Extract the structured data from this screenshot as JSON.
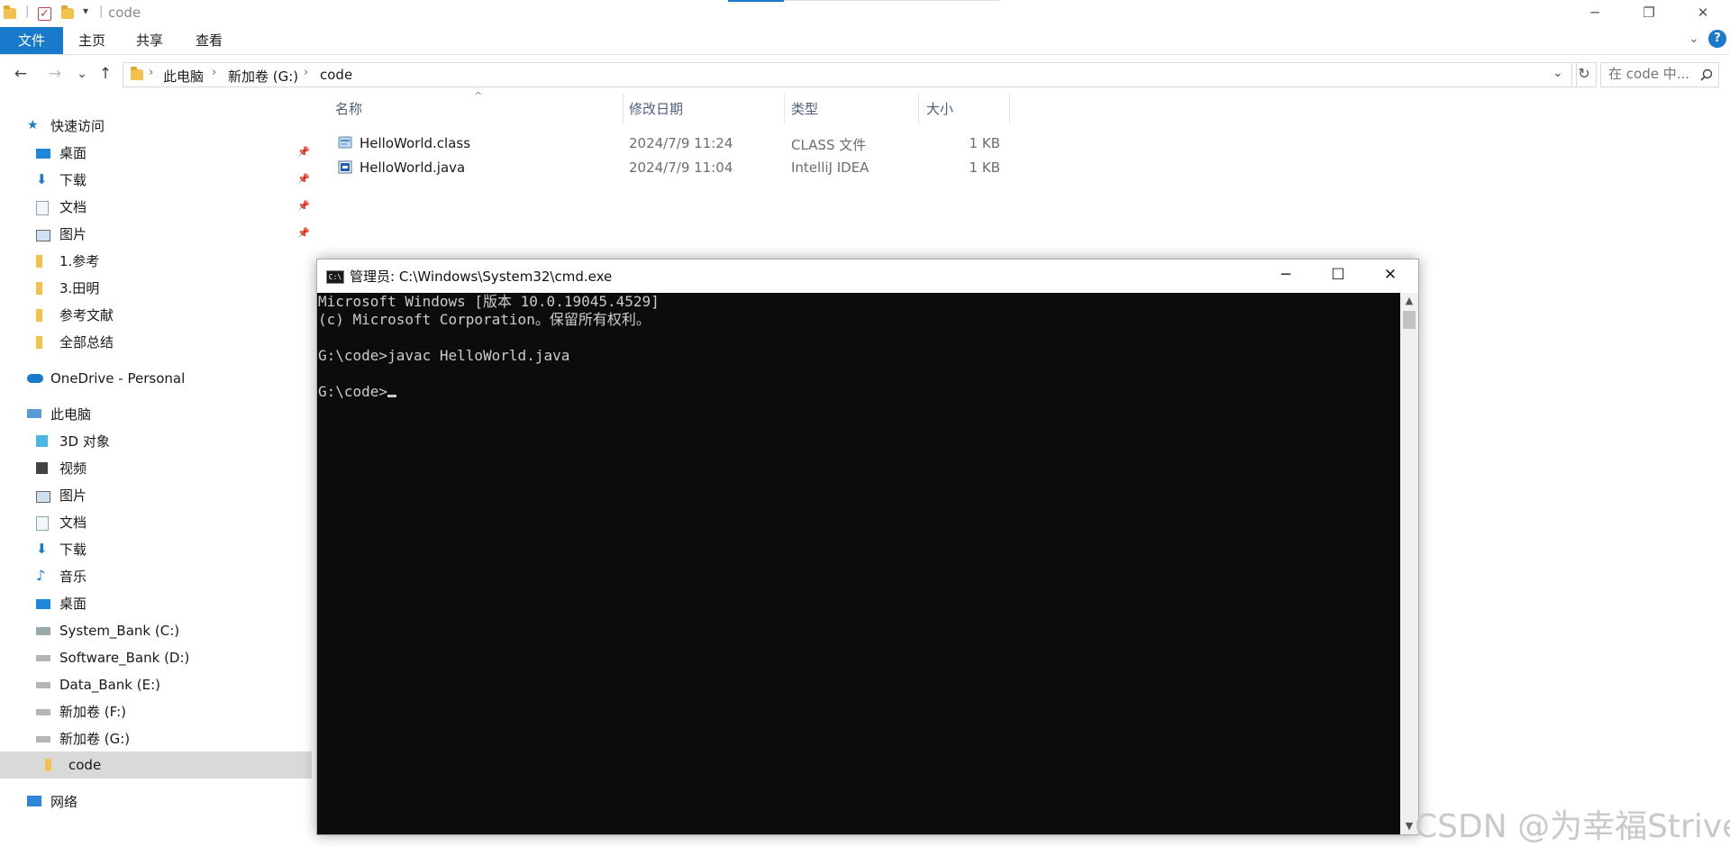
{
  "explorer": {
    "title": "code",
    "window_min": "─",
    "window_restore": "❐",
    "window_close": "✕",
    "ribbon_tabs": [
      "文件",
      "主页",
      "共享",
      "查看"
    ],
    "ribbon_help": "?",
    "nav": {
      "back": "←",
      "forward": "→",
      "recent": "⌄",
      "up": "↑"
    },
    "breadcrumbs": [
      "此电脑",
      "新加卷 (G:)",
      "code"
    ],
    "crumb_sep": "›",
    "search_placeholder": "在 code 中...",
    "search_icon": "search-icon",
    "columns": {
      "name": "名称",
      "modified": "修改日期",
      "type": "类型",
      "size": "大小"
    },
    "files": [
      {
        "name": "HelloWorld.class",
        "modified": "2024/7/9 11:24",
        "type": "CLASS 文件",
        "size": "1 KB",
        "icon": "class-file-icon"
      },
      {
        "name": "HelloWorld.java",
        "modified": "2024/7/9 11:04",
        "type": "IntelliJ IDEA",
        "size": "1 KB",
        "icon": "java-file-icon"
      }
    ],
    "sidebar": {
      "quick_access": {
        "label": "快速访问",
        "icon": "star-icon"
      },
      "quick_items": [
        {
          "label": "桌面",
          "icon": "desktop-icon",
          "pinned": true
        },
        {
          "label": "下载",
          "icon": "download-icon",
          "pinned": true
        },
        {
          "label": "文档",
          "icon": "document-icon",
          "pinned": true
        },
        {
          "label": "图片",
          "icon": "picture-icon",
          "pinned": true
        },
        {
          "label": "1.参考",
          "icon": "folder-icon",
          "pinned": false
        },
        {
          "label": "3.田明",
          "icon": "folder-icon",
          "pinned": false
        },
        {
          "label": "参考文献",
          "icon": "folder-icon",
          "pinned": false
        },
        {
          "label": "全部总结",
          "icon": "folder-icon",
          "pinned": false
        }
      ],
      "onedrive": {
        "label": "OneDrive - Personal",
        "icon": "cloud-icon"
      },
      "this_pc": {
        "label": "此电脑",
        "icon": "computer-icon"
      },
      "pc_items": [
        {
          "label": "3D 对象",
          "icon": "cube-icon"
        },
        {
          "label": "视频",
          "icon": "video-icon"
        },
        {
          "label": "图片",
          "icon": "picture-icon"
        },
        {
          "label": "文档",
          "icon": "document-icon"
        },
        {
          "label": "下载",
          "icon": "download-icon"
        },
        {
          "label": "音乐",
          "icon": "music-icon"
        },
        {
          "label": "桌面",
          "icon": "desktop-icon"
        },
        {
          "label": "System_Bank (C:)",
          "icon": "system-drive-icon"
        },
        {
          "label": "Software_Bank (D:)",
          "icon": "drive-icon"
        },
        {
          "label": "Data_Bank (E:)",
          "icon": "drive-icon"
        },
        {
          "label": "新加卷 (F:)",
          "icon": "drive-icon"
        },
        {
          "label": "新加卷 (G:)",
          "icon": "drive-icon"
        }
      ],
      "selected": {
        "label": "code",
        "icon": "folder-icon"
      },
      "network": {
        "label": "网络",
        "icon": "network-icon"
      }
    }
  },
  "cmd": {
    "title": "管理员: C:\\Windows\\System32\\cmd.exe",
    "icon_text": "C:\\",
    "min": "─",
    "max": "☐",
    "close": "✕",
    "lines": [
      "Microsoft Windows [版本 10.0.19045.4529]",
      "(c) Microsoft Corporation。保留所有权利。",
      "",
      "G:\\code>javac HelloWorld.java",
      ""
    ],
    "prompt": "G:\\code>",
    "scroll_up": "▲",
    "scroll_down": "▼"
  },
  "watermark": "CSDN @为幸福Strive",
  "colors": {
    "accent": "#1979ca",
    "console_bg": "#0c0c0c",
    "console_fg": "#cccccc",
    "selection": "#d9d9d9"
  }
}
